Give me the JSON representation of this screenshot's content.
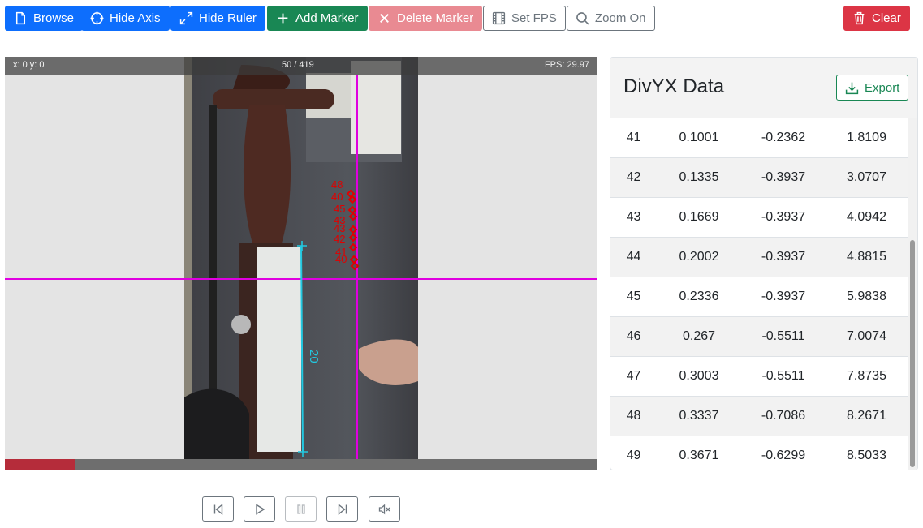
{
  "toolbar": {
    "browse": "Browse",
    "hide_axis": "Hide Axis",
    "hide_ruler": "Hide Ruler",
    "add_marker": "Add Marker",
    "delete_marker": "Delete Marker",
    "set_fps": "Set FPS",
    "zoom_on": "Zoom On",
    "clear": "Clear"
  },
  "video": {
    "coords": "x: 0 y: 0",
    "frame_counter": "50 / 419",
    "fps": "FPS: 29.97",
    "progress_fraction": 0.119,
    "ruler_label": "20",
    "marker_labels": [
      "48",
      "40",
      "45",
      "43",
      "43",
      "42",
      "41",
      "40"
    ],
    "colors": {
      "axis": "#e000e0",
      "ruler": "#22c8e0",
      "marker": "#e00000",
      "progress": "#b52c3a"
    }
  },
  "panel": {
    "title": "DivYX Data",
    "export_label": "Export",
    "rows": [
      [
        "41",
        "0.1001",
        "-0.2362",
        "1.8109"
      ],
      [
        "42",
        "0.1335",
        "-0.3937",
        "3.0707"
      ],
      [
        "43",
        "0.1669",
        "-0.3937",
        "4.0942"
      ],
      [
        "44",
        "0.2002",
        "-0.3937",
        "4.8815"
      ],
      [
        "45",
        "0.2336",
        "-0.3937",
        "5.9838"
      ],
      [
        "46",
        "0.267",
        "-0.5511",
        "7.0074"
      ],
      [
        "47",
        "0.3003",
        "-0.5511",
        "7.8735"
      ],
      [
        "48",
        "0.3337",
        "-0.7086",
        "8.2671"
      ],
      [
        "49",
        "0.3671",
        "-0.6299",
        "8.5033"
      ]
    ]
  },
  "playback": {
    "icons": [
      "skip-back-icon",
      "play-icon",
      "pause-icon",
      "skip-forward-icon",
      "mute-icon"
    ]
  }
}
